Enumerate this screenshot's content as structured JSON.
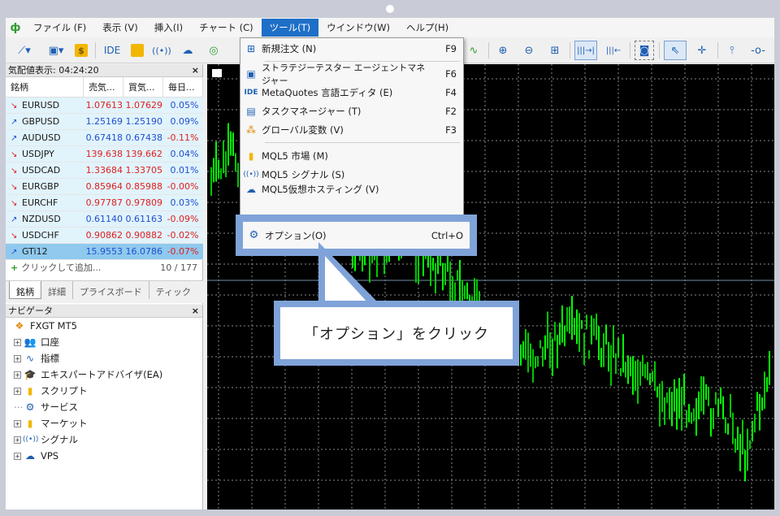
{
  "menu": {
    "items": [
      "ファイル (F)",
      "表示 (V)",
      "挿入(I)",
      "チャート (C)",
      "ツール(T)",
      "ウインドウ(W)",
      "ヘルプ(H)"
    ]
  },
  "toolbar": {
    "ide_label": "IDE"
  },
  "market_watch": {
    "title": "気配値表示: 04:24:20",
    "headers": [
      "銘柄",
      "売気...",
      "買気...",
      "毎日..."
    ],
    "rows": [
      {
        "symbol": "EURUSD",
        "dir": "down",
        "bid": "1.07613",
        "ask": "1.07629",
        "change": "0.05%"
      },
      {
        "symbol": "GBPUSD",
        "dir": "up",
        "bid": "1.25169",
        "ask": "1.25190",
        "change": "0.09%"
      },
      {
        "symbol": "AUDUSD",
        "dir": "up",
        "bid": "0.67418",
        "ask": "0.67438",
        "change": "-0.11%"
      },
      {
        "symbol": "USDJPY",
        "dir": "down",
        "bid": "139.638",
        "ask": "139.662",
        "change": "0.04%"
      },
      {
        "symbol": "USDCAD",
        "dir": "down",
        "bid": "1.33684",
        "ask": "1.33705",
        "change": "0.01%"
      },
      {
        "symbol": "EURGBP",
        "dir": "down",
        "bid": "0.85964",
        "ask": "0.85988",
        "change": "-0.00%"
      },
      {
        "symbol": "EURCHF",
        "dir": "down",
        "bid": "0.97787",
        "ask": "0.97809",
        "change": "0.03%"
      },
      {
        "symbol": "NZDUSD",
        "dir": "up",
        "bid": "0.61140",
        "ask": "0.61163",
        "change": "-0.09%"
      },
      {
        "symbol": "USDCHF",
        "dir": "down",
        "bid": "0.90862",
        "ask": "0.90882",
        "change": "-0.02%"
      },
      {
        "symbol": "GTi12",
        "dir": "up",
        "bid": "15.9553",
        "ask": "16.0786",
        "change": "-0.07%"
      }
    ],
    "add_label": "クリックして追加...",
    "count": "10 / 177",
    "tabs": [
      "銘柄",
      "詳細",
      "プライスボード",
      "ティック"
    ]
  },
  "navigator": {
    "title": "ナビゲータ",
    "root": "FXGT MT5",
    "items": [
      "口座",
      "指標",
      "エキスパートアドバイザ(EA)",
      "スクリプト",
      "サービス",
      "マーケット",
      "シグナル",
      "VPS"
    ]
  },
  "tools_menu": {
    "items": [
      {
        "label": "新規注文 (N)",
        "key": "F9",
        "icon": "new-order-icon"
      },
      {
        "label": "ストラテジーテスター エージェントマネジャー",
        "key": "F6",
        "icon": "chip-icon"
      },
      {
        "label": "MetaQuotes 言語エディタ (E)",
        "key": "F4",
        "icon": "ide-icon"
      },
      {
        "label": "タスクマネージャー (T)",
        "key": "F2",
        "icon": "task-manager-icon"
      },
      {
        "label": "グローバル変数 (V)",
        "key": "F3",
        "icon": "global-variables-icon"
      },
      {
        "label": "MQL5 市場 (M)",
        "key": "",
        "icon": "market-bag-icon"
      },
      {
        "label": "MQL5 シグナル (S)",
        "key": "",
        "icon": "signal-icon"
      },
      {
        "label": "MQL5仮想ホスティング (V)",
        "key": "",
        "icon": "cloud-icon"
      }
    ],
    "options": {
      "label": "オプション(O)",
      "key": "Ctrl+O",
      "icon": "gear-icon"
    }
  },
  "callout": {
    "text": "「オプション」をクリック"
  },
  "colors": {
    "accent": "#7fa3d8",
    "menu_active": "#1e6fc7",
    "candle": "#00ff00"
  }
}
